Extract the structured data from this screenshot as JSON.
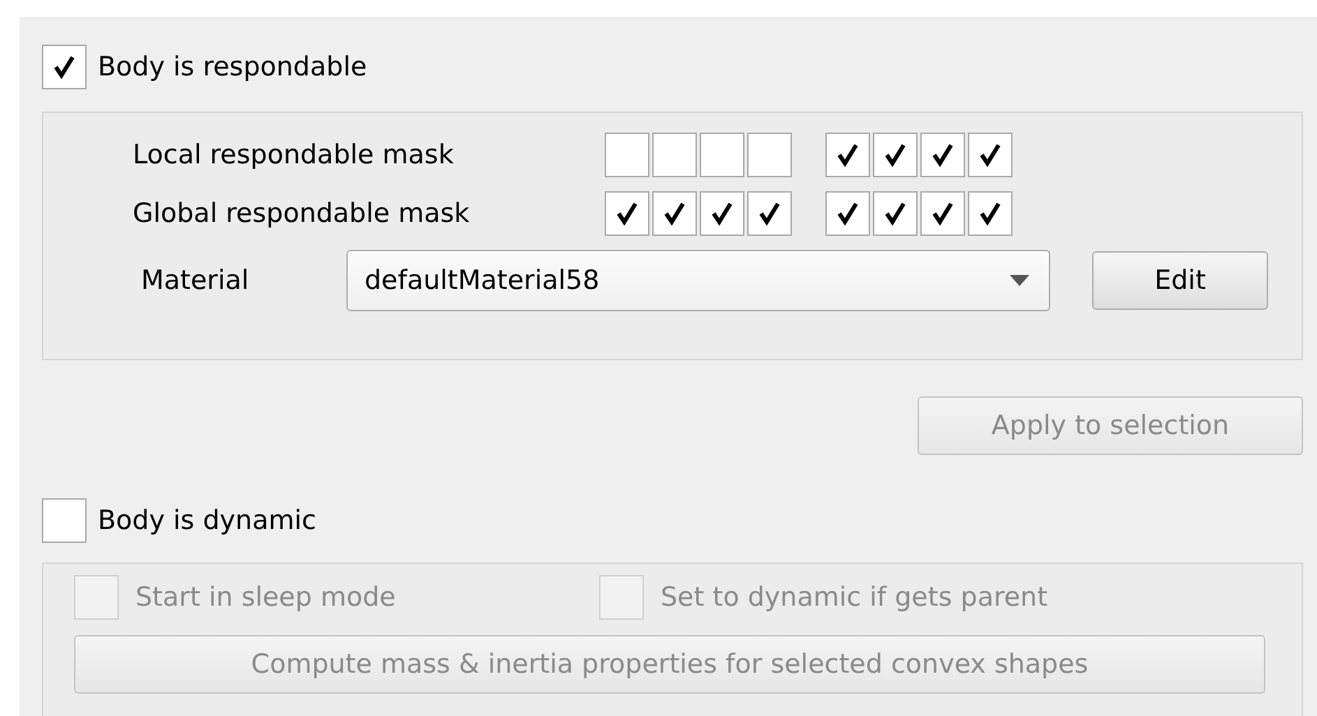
{
  "respondable": {
    "label": "Body is respondable",
    "checked": true,
    "masks": [
      {
        "label": "Local respondable mask",
        "bits": [
          false,
          false,
          false,
          false,
          true,
          true,
          true,
          true
        ]
      },
      {
        "label": "Global respondable mask",
        "bits": [
          true,
          true,
          true,
          true,
          true,
          true,
          true,
          true
        ]
      }
    ],
    "material": {
      "label": "Material",
      "value": "defaultMaterial58"
    },
    "edit_button": "Edit"
  },
  "apply_button": {
    "label": "Apply to selection",
    "disabled": true
  },
  "dynamic": {
    "label": "Body is dynamic",
    "checked": false,
    "options": [
      {
        "label": "Start in sleep mode",
        "checked": false,
        "disabled": true
      },
      {
        "label": "Set to dynamic if gets parent",
        "checked": false,
        "disabled": true
      }
    ],
    "compute_button": {
      "label": "Compute mass & inertia properties for selected convex shapes",
      "disabled": true
    }
  }
}
